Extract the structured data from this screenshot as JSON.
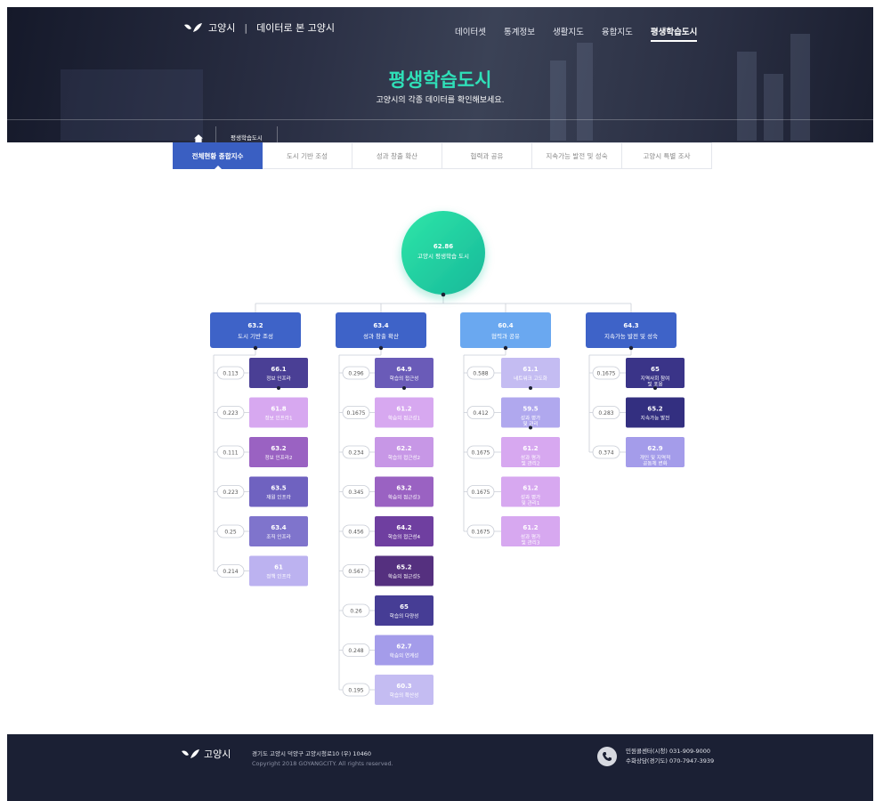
{
  "header": {
    "logo_text": "고양시",
    "logo_subtitle": "데이터로 본 고양시",
    "nav": [
      "데이터셋",
      "통계정보",
      "생활지도",
      "융합지도",
      "평생학습도시"
    ],
    "active_nav": "평생학습도시",
    "title": "평생학습도시",
    "subtitle": "고양시의 각종 데이터를 확인해보세요."
  },
  "breadcrumb": {
    "home_icon": "home-icon",
    "current": "평생학습도시"
  },
  "tabs": [
    "전체현황 종합지수",
    "도시 기반 조성",
    "성과 창출 확산",
    "협력과 공유",
    "지속가능 발전 및 성숙",
    "고양시 특별 조사"
  ],
  "active_tab": "전체현황 종합지수",
  "root": {
    "value": "62.86",
    "label": "고양시 평생학습 도시"
  },
  "colors": {
    "accent": "#3a5fc2",
    "root_start": "#2ee6a8",
    "root_end": "#17b89a",
    "cat_blue": "#3e63c8",
    "cat_light": "#6aa8f0",
    "navy": "#2f3a8a"
  },
  "categories": [
    {
      "value": "63.2",
      "label": "도시 기반 조성",
      "color": "#3e63c8",
      "items": [
        {
          "weight": "0.113",
          "value": "66.1",
          "label": "정보 인프라",
          "color": "#4a3f95"
        },
        {
          "weight": "0.223",
          "value": "61.8",
          "label": "정보 인프라1",
          "color": "#d7a8f0"
        },
        {
          "weight": "0.111",
          "value": "63.2",
          "label": "정보 인프라2",
          "color": "#9a62c2"
        },
        {
          "weight": "0.223",
          "value": "63.5",
          "label": "재원 인프라",
          "color": "#6f62c0"
        },
        {
          "weight": "0.25",
          "value": "63.4",
          "label": "조직 인프라",
          "color": "#7f74cc"
        },
        {
          "weight": "0.214",
          "value": "61",
          "label": "정책 인프라",
          "color": "#bcb2f0"
        }
      ]
    },
    {
      "value": "63.4",
      "label": "성과 창출 확산",
      "color": "#3e63c8",
      "items": [
        {
          "weight": "0.296",
          "value": "64.9",
          "label": "학습의 접근성",
          "color": "#6a5bb8"
        },
        {
          "weight": "0.1675",
          "value": "61.2",
          "label": "학습의 접근성1",
          "color": "#d7a8f0"
        },
        {
          "weight": "0.234",
          "value": "62.2",
          "label": "학습의 접근성2",
          "color": "#c797e6"
        },
        {
          "weight": "0.345",
          "value": "63.2",
          "label": "학습의 접근성3",
          "color": "#9a62c2"
        },
        {
          "weight": "0.456",
          "value": "64.2",
          "label": "학습의 접근성4",
          "color": "#6f3fa0"
        },
        {
          "weight": "0.567",
          "value": "65.2",
          "label": "학습의 접근성5",
          "color": "#55307f"
        },
        {
          "weight": "0.26",
          "value": "65",
          "label": "학습의 다양성",
          "color": "#463d95"
        },
        {
          "weight": "0.248",
          "value": "62.7",
          "label": "학습의 연계성",
          "color": "#a49cea"
        },
        {
          "weight": "0.195",
          "value": "60.3",
          "label": "학습의 확산성",
          "color": "#c4bcf2"
        }
      ]
    },
    {
      "value": "60.4",
      "label": "협력과 공유",
      "color": "#6aa8f0",
      "items": [
        {
          "weight": "0.588",
          "value": "61.1",
          "label": "네트워크 고도화",
          "color": "#c4bcf2"
        },
        {
          "weight": "0.412",
          "value": "59.5",
          "label": "성과 평가 및 관리",
          "color": "#b0a8ee"
        },
        {
          "weight": "0.1675",
          "value": "61.2",
          "label": "성과 평가 및 관리2",
          "color": "#d7a8f0"
        },
        {
          "weight": "0.1675",
          "value": "61.2",
          "label": "성과 평가 및 관리1",
          "color": "#d7a8f0"
        },
        {
          "weight": "0.1675",
          "value": "61.2",
          "label": "성과 평가 및 관리3",
          "color": "#d7a8f0"
        }
      ]
    },
    {
      "value": "64.3",
      "label": "지속가능 발전 및 성숙",
      "color": "#3e63c8",
      "items": [
        {
          "weight": "0.1675",
          "value": "65",
          "label": "지역사회 참여 및 포용",
          "color": "#3a3488"
        },
        {
          "weight": "0.283",
          "value": "65.2",
          "label": "지속가능 발전",
          "color": "#332f80"
        },
        {
          "weight": "0.374",
          "value": "62.9",
          "label": "개인 및 지역적 공동체 변화",
          "color": "#a49cea"
        }
      ]
    }
  ],
  "footer": {
    "logo_text": "고양시",
    "address": "경기도 고양시 덕양구 고양시청로10 (우) 10460",
    "copyright": "Copyright 2018 GOYANGCITY. All rights reserved.",
    "phone1": "민원콜센터(시청) 031-909-9000",
    "phone2": "수화상담(경기도) 070-7947-3939",
    "phone_icon": "phone-icon"
  }
}
